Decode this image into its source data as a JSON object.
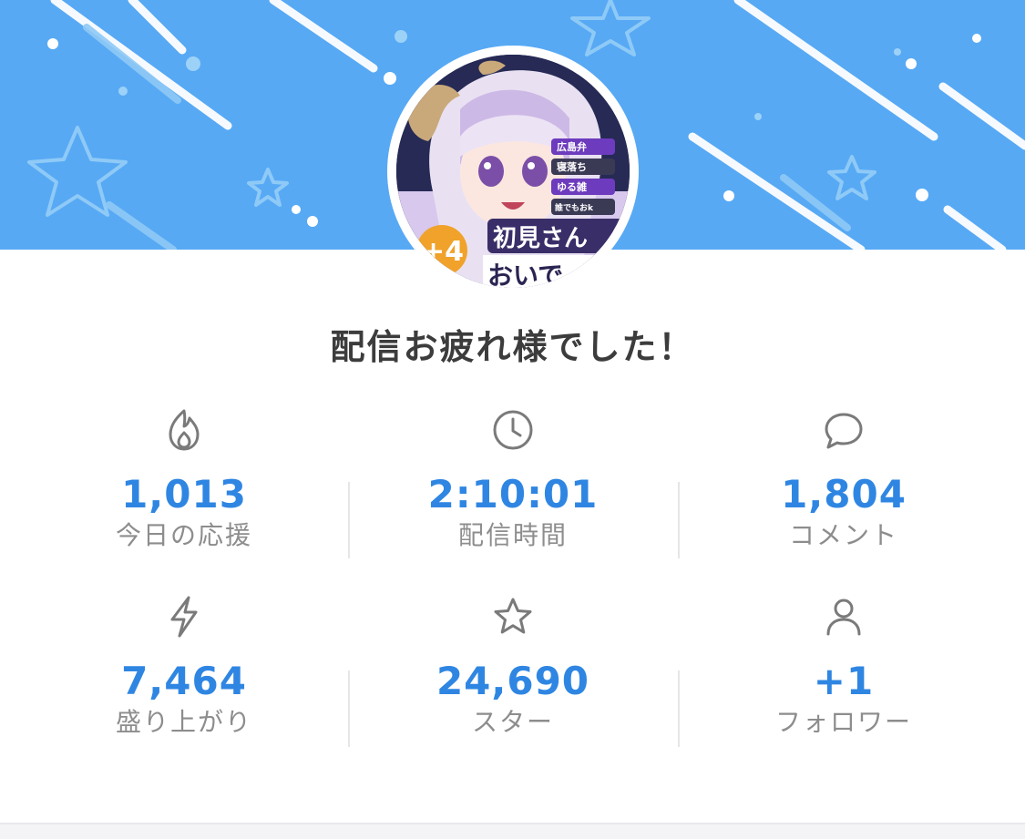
{
  "headline": "配信お疲れ様でした！",
  "avatar": {
    "overlay_tags": [
      "広島弁",
      "寝落ち",
      "ゆる雑",
      "誰でもおk"
    ],
    "overlay_caption_line1": "初見さん",
    "overlay_caption_line2": "おいで",
    "overlay_badge": "+4"
  },
  "colors": {
    "banner": "#57a9f4",
    "value_blue": "#2f86e2",
    "label_gray": "#8d8d8d",
    "icon_gray": "#7a7a7a"
  },
  "stats": [
    {
      "icon": "flame-icon",
      "value": "1,013",
      "label": "今日の応援"
    },
    {
      "icon": "clock-icon",
      "value": "2:10:01",
      "label": "配信時間"
    },
    {
      "icon": "comment-bubble-icon",
      "value": "1,804",
      "label": "コメント"
    },
    {
      "icon": "lightning-icon",
      "value": "7,464",
      "label": "盛り上がり"
    },
    {
      "icon": "star-icon",
      "value": "24,690",
      "label": "スター"
    },
    {
      "icon": "person-icon",
      "value": "+1",
      "label": "フォロワー"
    }
  ]
}
